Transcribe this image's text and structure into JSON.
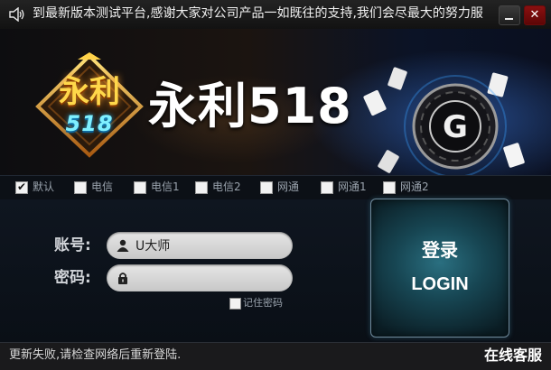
{
  "titlebar": {
    "notice": "到最新版本测试平台,感谢大家对公司产品一如既往的支持,我们会尽最大的努力服",
    "icons": {
      "speaker": "speaker-icon",
      "minimize": "minimize-icon",
      "close": "close-icon"
    },
    "close_glyph": "✕"
  },
  "banner": {
    "logo_top": "永利",
    "logo_number": "518",
    "brand_name": "永利518",
    "casino_chip_letter": "G"
  },
  "line_options": [
    {
      "label": "默认",
      "checked": true
    },
    {
      "label": "电信",
      "checked": false
    },
    {
      "label": "电信1",
      "checked": false
    },
    {
      "label": "电信2",
      "checked": false
    },
    {
      "label": "网通",
      "checked": false
    },
    {
      "label": "网通1",
      "checked": false
    },
    {
      "label": "网通2",
      "checked": false
    }
  ],
  "login_form": {
    "account_label": "账号:",
    "account_value": "U大师",
    "password_label": "密码:",
    "password_value": "",
    "remember_label": "记住密码",
    "remember_checked": false,
    "icons": {
      "account": "user-icon",
      "password": "lock-icon"
    }
  },
  "login_button": {
    "label_cn": "登录",
    "label_en": "LOGIN"
  },
  "statusbar": {
    "message": "更新失败,请检查网络后重新登陆.",
    "service_link": "在线客服"
  },
  "colors": {
    "accent_button": "#174653",
    "close_button": "#8a1010",
    "logo_gold": "#ffd84a",
    "logo_cyan": "#7ff0ff"
  }
}
